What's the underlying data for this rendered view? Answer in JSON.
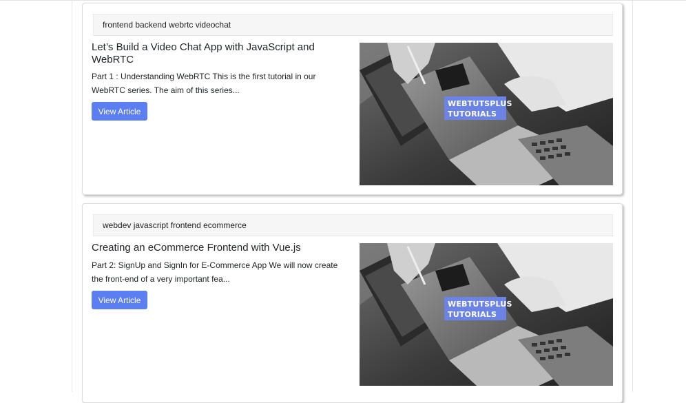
{
  "articles": [
    {
      "tags": "frontend backend webrtc videochat",
      "title": "Let’s Build a Video Chat App with JavaScript and WebRTC",
      "excerpt": "Part 1 : Understanding WebRTC This is the first tutorial in our WebRTC series. The aim of this series...",
      "button_label": "View Article",
      "image_watermark": [
        "WEBTUTSPLUS",
        "TUTORIALS"
      ]
    },
    {
      "tags": "webdev javascript frontend ecommerce",
      "title": "Creating an eCommerce Frontend with Vue.js",
      "excerpt": "Part 2: SignUp and SignIn for E-Commerce App We will now create the front-end of a very important fea...",
      "button_label": "View Article",
      "image_watermark": [
        "WEBTUTSPLUS",
        "TUTORIALS"
      ]
    }
  ],
  "colors": {
    "button": "#5b7ff0",
    "watermark": "#6b83e4",
    "tagbar": "#f6f6f7"
  }
}
